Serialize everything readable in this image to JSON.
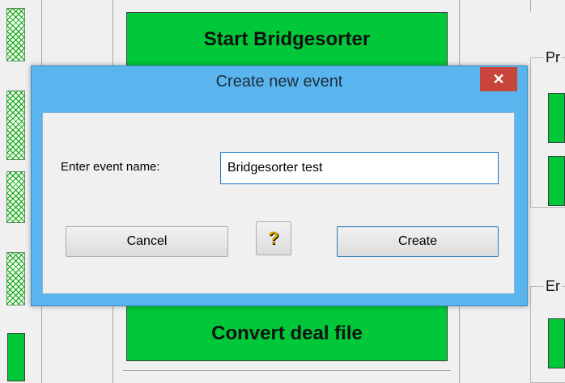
{
  "background": {
    "buttons": {
      "start_label": "Start Bridgesorter",
      "convert_label": "Convert deal file"
    },
    "groups": {
      "top_label": "Pr",
      "bottom_label": "Er"
    }
  },
  "dialog": {
    "title": "Create new event",
    "close_glyph": "✕",
    "field_label": "Enter event name:",
    "field_value": "Bridgesorter test",
    "cancel_label": "Cancel",
    "help_glyph": "?",
    "create_label": "Create",
    "help_icon": "help-question-icon"
  },
  "colors": {
    "accent_green": "#00c838",
    "dialog_frame": "#5ab4ee",
    "close_red": "#c7453b"
  }
}
